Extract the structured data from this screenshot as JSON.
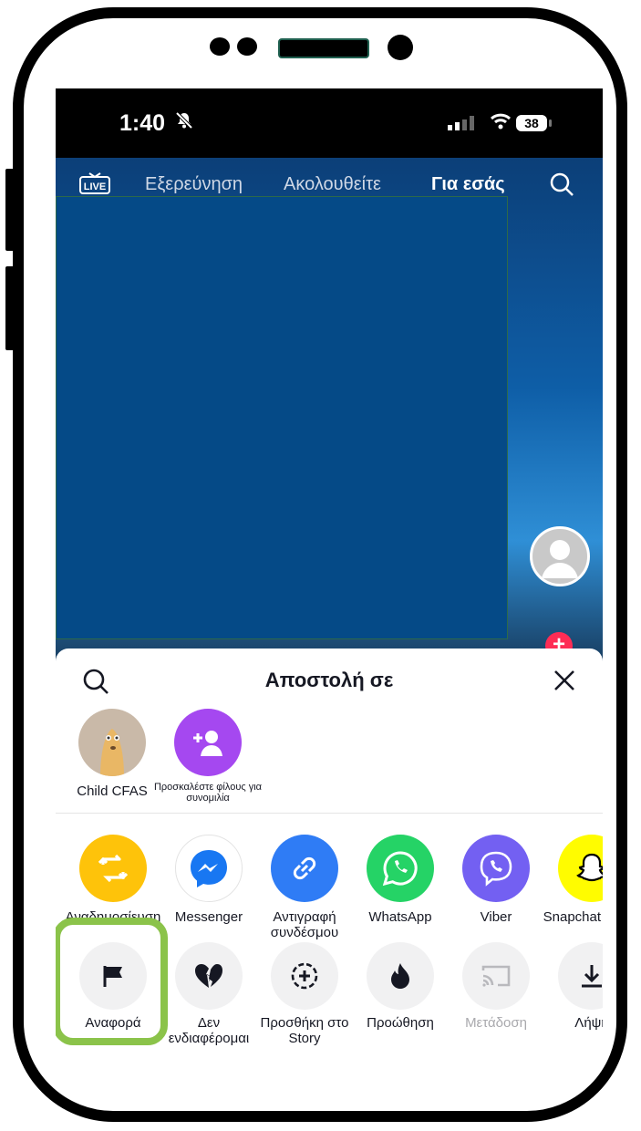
{
  "status_bar": {
    "time": "1:40",
    "battery": "38"
  },
  "top_nav": {
    "live_label": "LIVE",
    "explore": "Εξερεύνηση",
    "following": "Ακολουθείτε",
    "for_you": "Για εσάς"
  },
  "share_sheet": {
    "title": "Αποστολή σε",
    "contacts": [
      {
        "name": "Child CFAS"
      },
      {
        "name": "Προσκαλέστε φίλους για συνομιλία"
      }
    ],
    "apps": [
      {
        "label": "Αναδημοσίευση",
        "icon": "repost-icon",
        "color": "#fec30a"
      },
      {
        "label": "Messenger",
        "icon": "messenger-icon",
        "color": "#1877f2"
      },
      {
        "label": "Αντιγραφή συνδέσμου",
        "icon": "link-icon",
        "color": "#2f7cf5"
      },
      {
        "label": "WhatsApp",
        "icon": "whatsapp-icon",
        "color": "#25d366"
      },
      {
        "label": "Viber",
        "icon": "viber-icon",
        "color": "#7360f2"
      },
      {
        "label": "Snapchat Chats",
        "icon": "snapchat-icon",
        "color": "#fffc00"
      }
    ],
    "actions": [
      {
        "label": "Αναφορά",
        "icon": "flag-icon"
      },
      {
        "label": "Δεν ενδιαφέρομαι",
        "icon": "broken-heart-icon"
      },
      {
        "label": "Προσθήκη στο Story",
        "icon": "add-story-icon"
      },
      {
        "label": "Προώθηση",
        "icon": "flame-icon"
      },
      {
        "label": "Μετάδοση",
        "icon": "cast-icon"
      },
      {
        "label": "Λήψη",
        "icon": "download-icon"
      }
    ]
  },
  "colors": {
    "highlight": "#8bc34a",
    "accent": "#fe2c55"
  }
}
